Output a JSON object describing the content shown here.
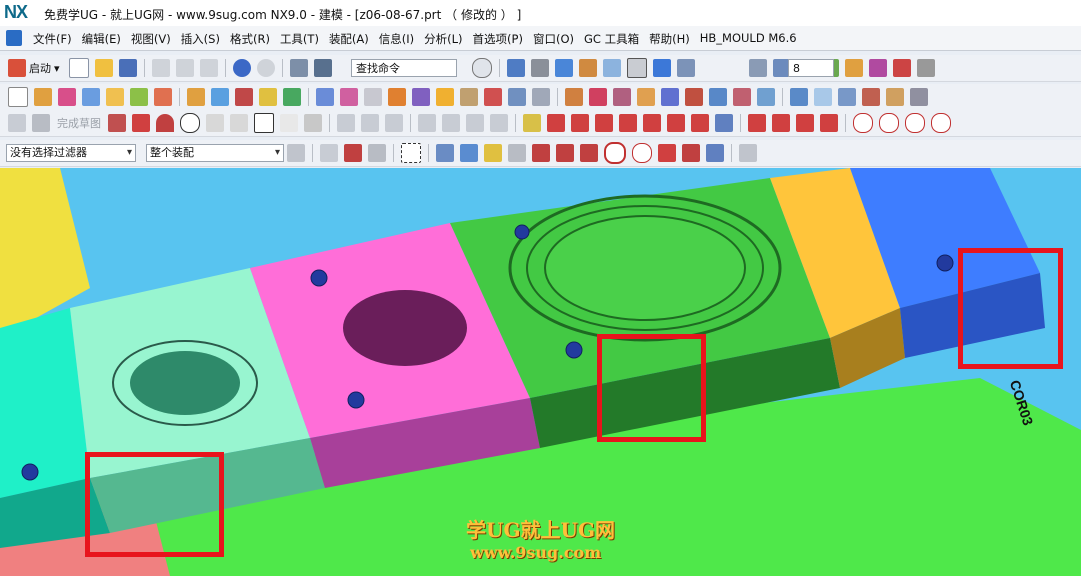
{
  "window": {
    "logo": "NX",
    "title": "免费学UG - 就上UG网 - www.9sug.com NX9.0 - 建模 - [z06-08-67.prt （ 修改的 ） ]"
  },
  "menu": {
    "items": [
      "文件(F)",
      "编辑(E)",
      "视图(V)",
      "插入(S)",
      "格式(R)",
      "工具(T)",
      "装配(A)",
      "信息(I)",
      "分析(L)",
      "首选项(P)",
      "窗口(O)",
      "GC 工具箱",
      "帮助(H)",
      "HB_MOULD M6.6"
    ]
  },
  "toolbar": {
    "start_label": "启动",
    "search_placeholder": "查找命令",
    "number_value": "8",
    "finish_sketch_label": "完成草图"
  },
  "filters": {
    "selection_filter": "没有选择过滤器",
    "assembly_scope": "整个装配"
  },
  "viewport": {
    "part_label": "COR03",
    "watermark_line1": "学UG就上UG网",
    "watermark_line2": "www.9sug.com",
    "highlight_color": "#e8141c"
  }
}
